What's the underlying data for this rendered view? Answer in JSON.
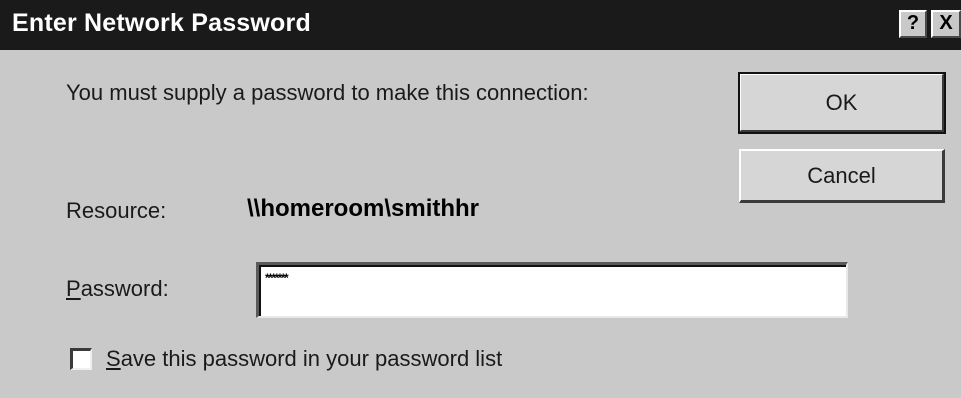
{
  "window": {
    "title": "Enter Network Password",
    "help_button": "?",
    "close_button": "X"
  },
  "dialog": {
    "message": "You must supply a password to make this connection:",
    "resource_label": "Resource:",
    "resource_value": "\\\\homeroom\\smithhr",
    "password_label_accel": "P",
    "password_label_rest": "assword:",
    "password_value": "*******",
    "save_checkbox": {
      "checked": false,
      "label_accel": "S",
      "label_rest": "ave this password in your password list"
    }
  },
  "buttons": {
    "ok": "OK",
    "cancel": "Cancel"
  }
}
